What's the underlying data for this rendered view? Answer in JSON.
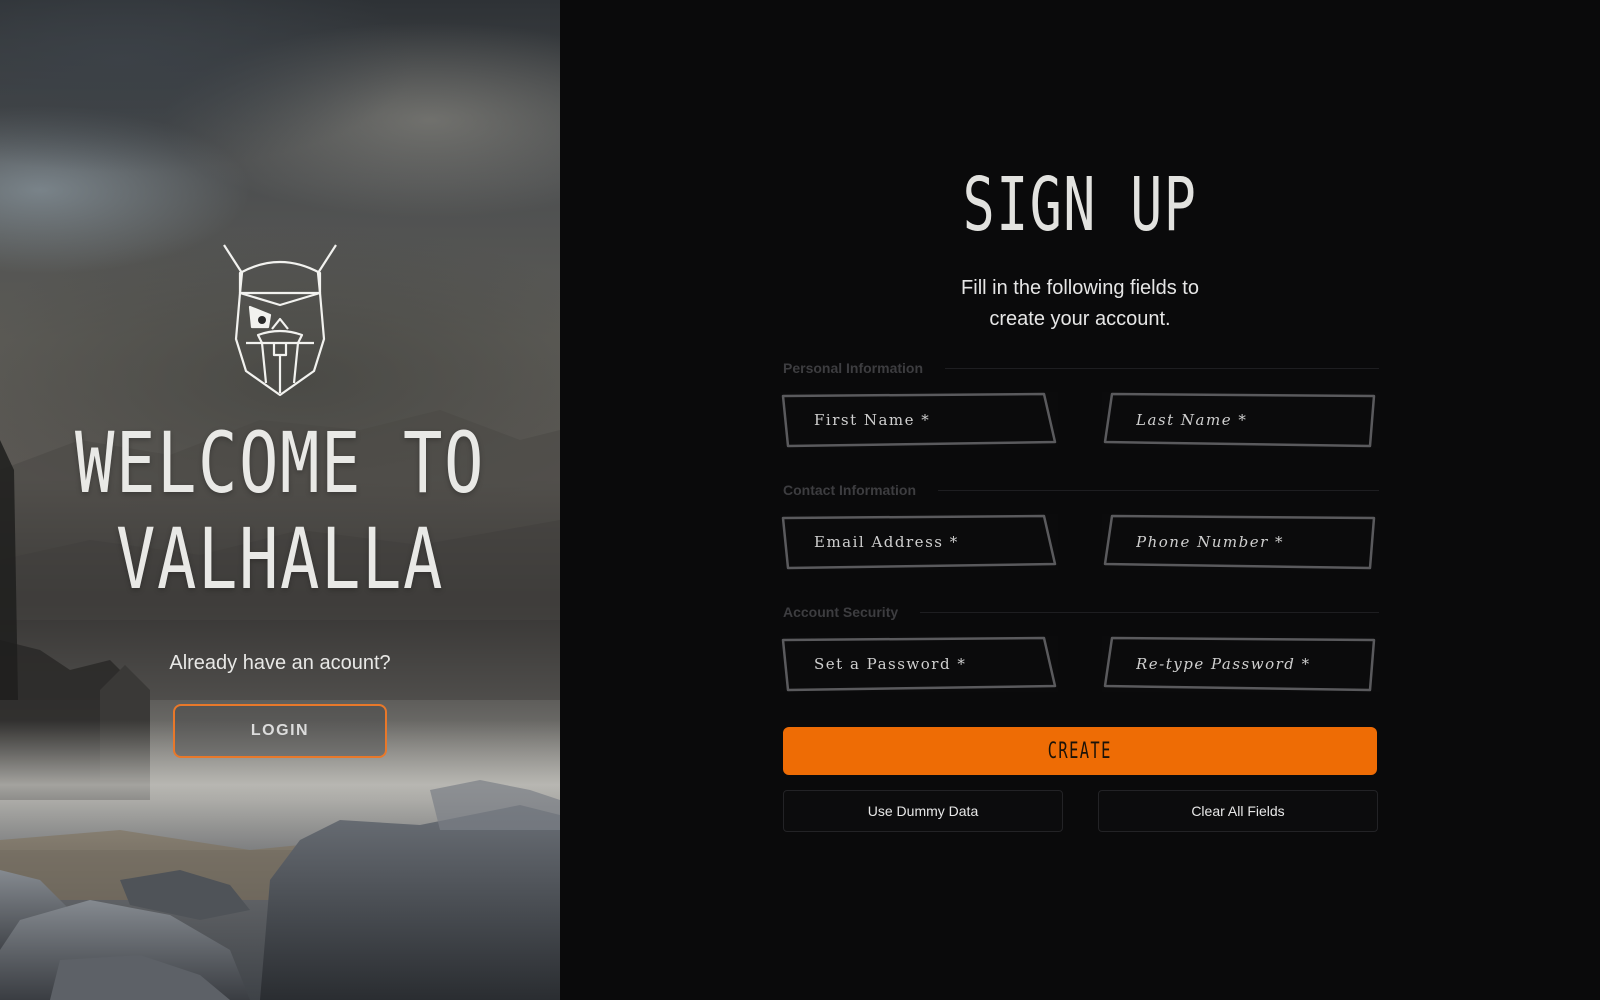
{
  "hero": {
    "welcome_line1": "WELCOME TO",
    "welcome_line2": "VALHALLA",
    "logo_icon": "viking-helmet-icon",
    "already_have_account": "Already have an acount?",
    "login_label": "LOGIN"
  },
  "form": {
    "title": "SIGN UP",
    "subtitle_line1": "Fill in the following fields to",
    "subtitle_line2": "create your account.",
    "sections": {
      "personal": "Personal Information",
      "contact": "Contact Information",
      "security": "Account Security"
    },
    "fields": {
      "first_name": "First Name *",
      "last_name": "Last Name *",
      "email": "Email Address *",
      "phone": "Phone Number *",
      "password": "Set a Password *",
      "retype_password": "Re-type Password *"
    },
    "create_label": "CREATE",
    "dummy_label": "Use Dummy Data",
    "clear_label": "Clear All Fields"
  },
  "colors": {
    "accent": "#ee6c05",
    "login_border": "#e8782a",
    "background": "#0a0a0b",
    "field_border": "#5a5a5d"
  }
}
